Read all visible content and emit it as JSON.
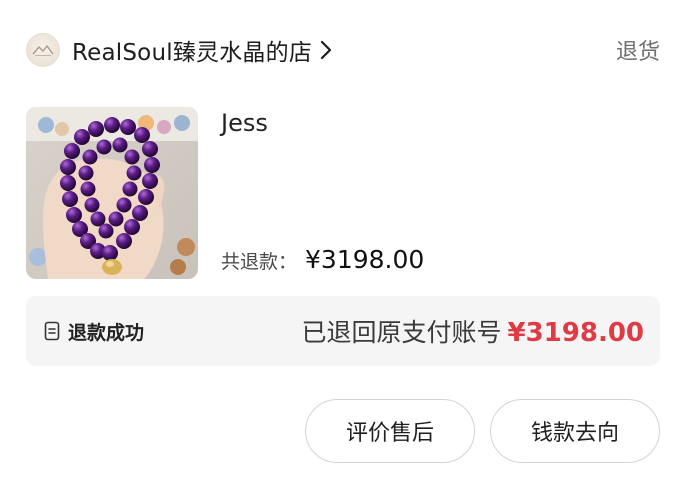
{
  "header": {
    "shop_name": "RealSoul臻灵水晶的店",
    "action_label": "退货",
    "avatar_icon": "shop-logo-icon",
    "chevron_icon": "chevron-right-icon"
  },
  "product": {
    "title": "Jess",
    "image": "amethyst-bracelet-photo",
    "refund_label": "共退款：",
    "refund_amount": "¥3198.00"
  },
  "status": {
    "icon": "document-icon",
    "text": "退款成功",
    "returned_label": "已退回原支付账号",
    "returned_amount": "¥3198.00",
    "amount_color": "#e03a45"
  },
  "buttons": {
    "review_label": "评价售后",
    "money_label": "钱款去向"
  }
}
